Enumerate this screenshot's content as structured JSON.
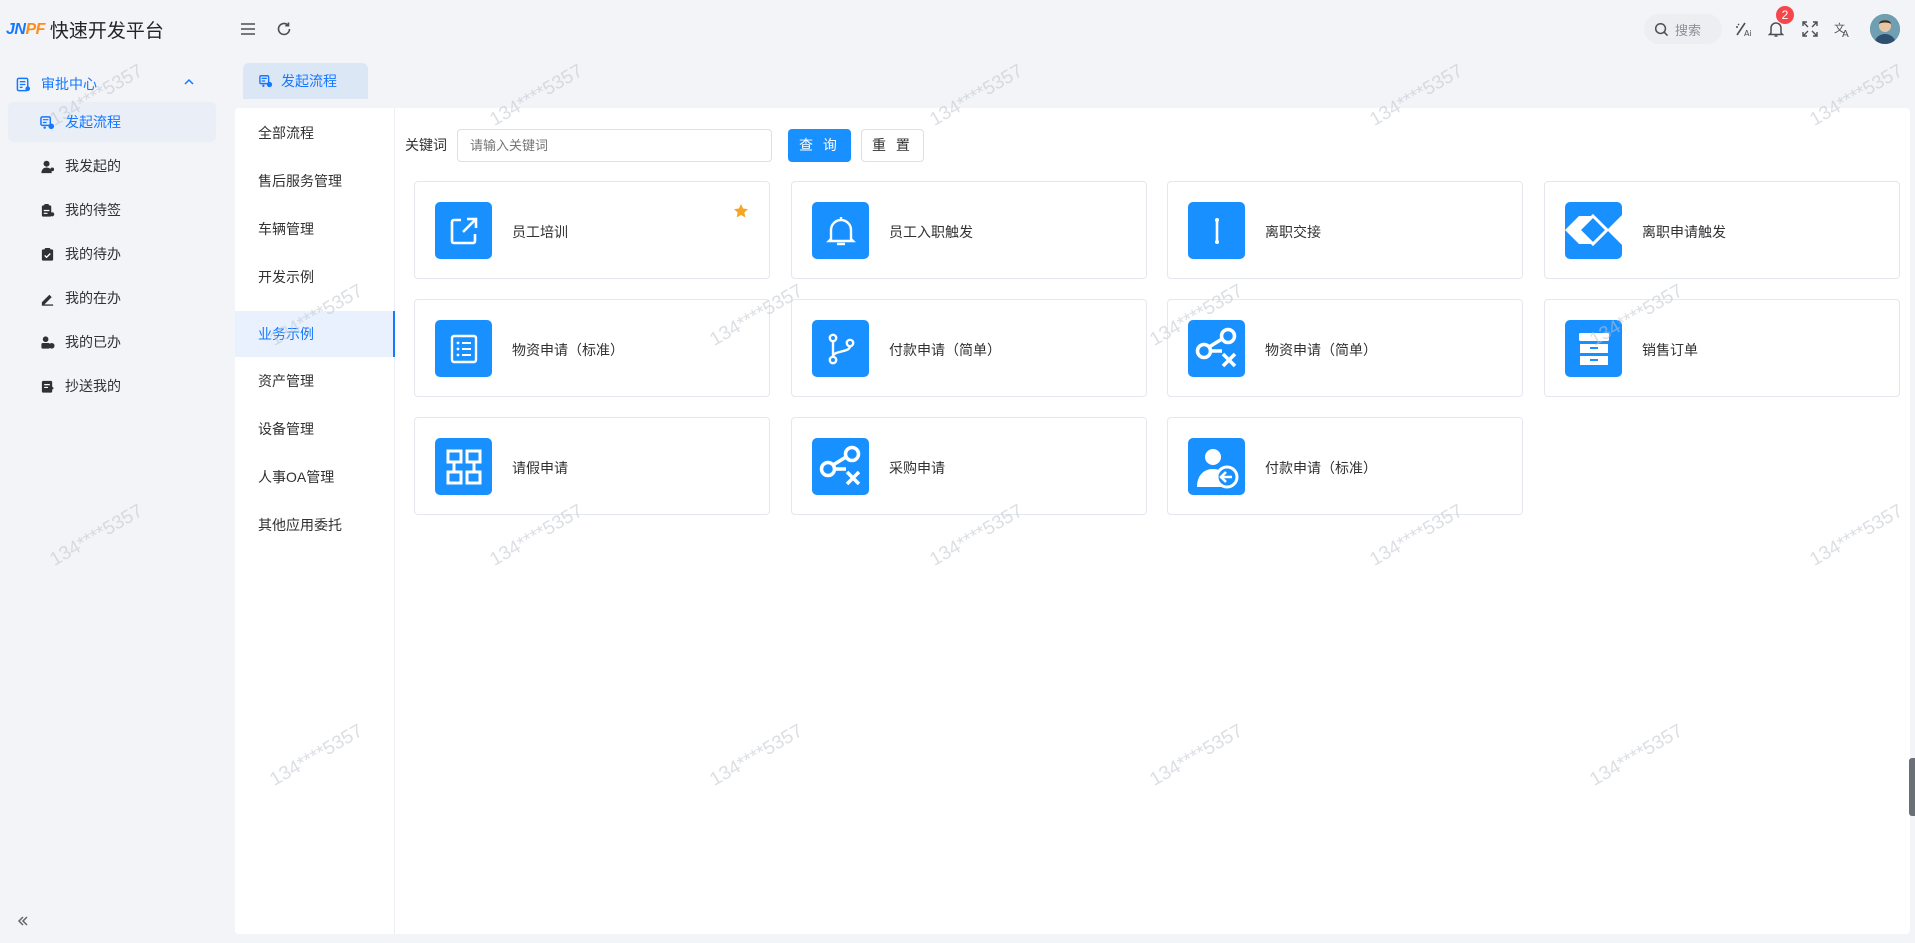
{
  "app": {
    "logo_mark": "JNPF",
    "title": "快速开发平台"
  },
  "header": {
    "search_placeholder": "搜索",
    "notification_count": "2"
  },
  "sidebar": {
    "group_label": "审批中心",
    "items": [
      {
        "label": "发起流程",
        "icon": "flow-start-icon",
        "active": true
      },
      {
        "label": "我发起的",
        "icon": "user-icon"
      },
      {
        "label": "我的待签",
        "icon": "clipboard-icon"
      },
      {
        "label": "我的待办",
        "icon": "todo-icon"
      },
      {
        "label": "我的在办",
        "icon": "edit-icon"
      },
      {
        "label": "我的已办",
        "icon": "done-icon"
      },
      {
        "label": "抄送我的",
        "icon": "cc-icon"
      }
    ]
  },
  "tabs": [
    {
      "label": "发起流程",
      "active": true
    }
  ],
  "categories": [
    {
      "label": "全部流程"
    },
    {
      "label": "售后服务管理"
    },
    {
      "label": "车辆管理"
    },
    {
      "label": "开发示例"
    },
    {
      "label": "业务示例",
      "active": true
    },
    {
      "label": "资产管理"
    },
    {
      "label": "设备管理"
    },
    {
      "label": "人事OA管理"
    },
    {
      "label": "其他应用委托"
    }
  ],
  "filter": {
    "label": "关键词",
    "placeholder": "请输入关键词",
    "query_label": "查 询",
    "reset_label": "重 置"
  },
  "cards": [
    {
      "name": "员工培训",
      "icon": "external-link-icon",
      "starred": true
    },
    {
      "name": "员工入职触发",
      "icon": "bell-icon"
    },
    {
      "name": "离职交接",
      "icon": "text-cursor-icon"
    },
    {
      "name": "离职申请触发",
      "icon": "diamond-icon"
    },
    {
      "name": "物资申请（标准）",
      "icon": "list-icon"
    },
    {
      "name": "付款申请（简单）",
      "icon": "branch-icon"
    },
    {
      "name": "物资申请（简单）",
      "icon": "node-x-icon"
    },
    {
      "name": "销售订单",
      "icon": "cabinet-icon"
    },
    {
      "name": "请假申请",
      "icon": "grid-icon"
    },
    {
      "name": "采购申请",
      "icon": "node-x-icon"
    },
    {
      "name": "付款申请（标准）",
      "icon": "user-back-icon"
    }
  ],
  "watermark": "134****5357",
  "colors": {
    "accent": "#1677ff",
    "icon_bg": "#1890ff",
    "active_bg": "#e9f1fe",
    "star": "#f5a623",
    "badge": "#f5474b"
  }
}
